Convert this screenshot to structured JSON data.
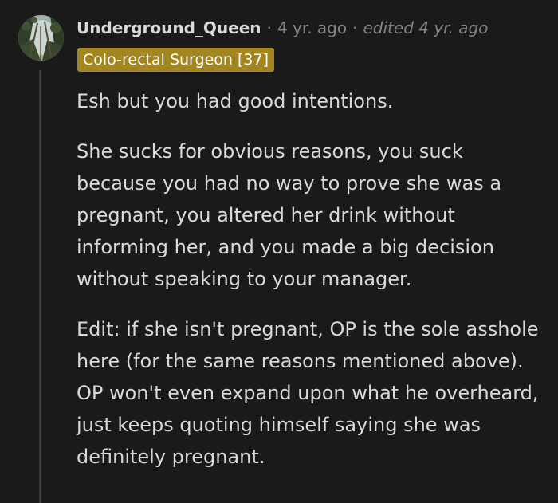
{
  "comment": {
    "avatar_icon": "tree-canopy-avatar",
    "username": "Underground_Queen",
    "separator": "·",
    "time": "4 yr. ago",
    "edited": "edited 4 yr. ago",
    "flair": "Colo-rectal Surgeon [37]",
    "flair_color": "#a3861f",
    "paragraphs": [
      "Esh but you had good intentions.",
      "She sucks for obvious reasons, you suck because you had no way to prove she was a pregnant, you altered her drink without informing her, and you made a big decision without speaking to your manager.",
      "Edit: if she isn't pregnant, OP is the sole asshole here (for the same reasons mentioned above). OP won't even expand upon what he overheard, just keeps quoting himself saying she was definitely pregnant."
    ]
  }
}
